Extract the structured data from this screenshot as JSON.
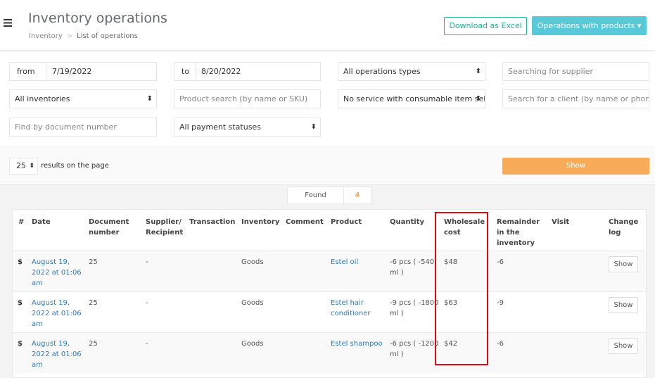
{
  "header": {
    "menu_icon": "hamburger-icon",
    "title": "Inventory operations",
    "breadcrumb": {
      "root": "Inventory",
      "separator": ">",
      "current": "List of operations"
    },
    "excel_button": "Download as Excel",
    "operations_button": "Operations with products ▾"
  },
  "filters": {
    "from_label": "from",
    "from_value": "7/19/2022",
    "to_label": "to",
    "to_value": "8/20/2022",
    "operation_types": "All operations types",
    "supplier_placeholder": "Searching for supplier",
    "inventories": "All inventories",
    "product_placeholder": "Product search (by name or SKU)",
    "service": "No service with consumable item sele",
    "client_placeholder": "Search for a client (by name or phone",
    "document_placeholder": "Find by document number",
    "payment_statuses": "All payment statuses"
  },
  "results": {
    "per_page": "25",
    "per_page_label": "results on the page",
    "show_button": "Show"
  },
  "found": {
    "label": "Found",
    "count": "4"
  },
  "table": {
    "headers": [
      "#",
      "Date",
      "Document number",
      "Supplier/ Recipient",
      "Transaction",
      "Inventory",
      "Comment",
      "Product",
      "Quantity",
      "Wholesale cost",
      "Remainder in the inventory",
      "Visit",
      "Change log"
    ],
    "rows": [
      {
        "icon": "$",
        "date": "August 19, 2022 at 01:06 am",
        "document": "25",
        "supplier": "-",
        "inventory": "Goods",
        "product": "Estel oil",
        "quantity": "-6 pcs ( -540 ml )",
        "cost": "$48",
        "remainder": "-6",
        "action": "Show"
      },
      {
        "icon": "$",
        "date": "August 19, 2022 at 01:06 am",
        "document": "25",
        "supplier": "-",
        "inventory": "Goods",
        "product": "Estel hair conditioner",
        "quantity": "-9 pcs ( -1800 ml )",
        "cost": "$63",
        "remainder": "-9",
        "action": "Show"
      },
      {
        "icon": "$",
        "date": "August 19, 2022 at 01:06 am",
        "document": "25",
        "supplier": "-",
        "inventory": "Goods",
        "product": "Estel shampoo",
        "quantity": "-6 pcs ( -1200 ml )",
        "cost": "$42",
        "remainder": "-6",
        "action": "Show"
      }
    ]
  },
  "colors": {
    "accent_teal": "#1ab394",
    "accent_cyan": "#58c9d8",
    "accent_orange": "#f8ac59",
    "highlight_red": "#e30613"
  }
}
